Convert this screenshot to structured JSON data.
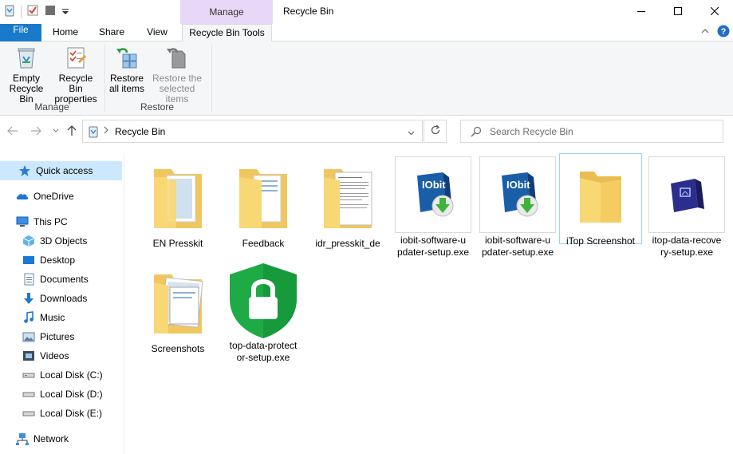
{
  "window": {
    "title": "Recycle Bin",
    "context_tab": "Manage"
  },
  "tabs": [
    {
      "label": "File"
    },
    {
      "label": "Home"
    },
    {
      "label": "Share"
    },
    {
      "label": "View"
    },
    {
      "label": "Recycle Bin Tools"
    }
  ],
  "ribbon": {
    "empty_line1": "Empty",
    "empty_line2": "Recycle Bin",
    "props_line1": "Recycle Bin",
    "props_line2": "properties",
    "manage_group": "Manage",
    "restore_all_line1": "Restore",
    "restore_all_line2": "all items",
    "restore_sel_line1": "Restore the",
    "restore_sel_line2": "selected items",
    "restore_group": "Restore"
  },
  "address": {
    "path": "Recycle Bin",
    "search_placeholder": "Search Recycle Bin"
  },
  "sidebar": {
    "items": [
      {
        "label": "Quick access",
        "icon": "star-icon"
      },
      {
        "label": "OneDrive",
        "icon": "cloud-icon"
      },
      {
        "label": "This PC",
        "icon": "computer-icon"
      },
      {
        "label": "3D Objects",
        "icon": "cube-icon"
      },
      {
        "label": "Desktop",
        "icon": "desktop-icon"
      },
      {
        "label": "Documents",
        "icon": "documents-icon"
      },
      {
        "label": "Downloads",
        "icon": "download-arrow-icon"
      },
      {
        "label": "Music",
        "icon": "music-note-icon"
      },
      {
        "label": "Pictures",
        "icon": "pictures-icon"
      },
      {
        "label": "Videos",
        "icon": "film-icon"
      },
      {
        "label": "Local Disk (C:)",
        "icon": "drive-icon"
      },
      {
        "label": "Local Disk (D:)",
        "icon": "drive-icon"
      },
      {
        "label": "Local Disk (E:)",
        "icon": "drive-icon"
      },
      {
        "label": "Network",
        "icon": "network-icon"
      }
    ]
  },
  "files": [
    {
      "line1": "EN Presskit",
      "line2": ""
    },
    {
      "line1": "Feedback",
      "line2": ""
    },
    {
      "line1": "idr_presskit_de",
      "line2": ""
    },
    {
      "line1": "iobit-software-u",
      "line2": "pdater-setup.exe"
    },
    {
      "line1": "iobit-software-u",
      "line2": "pdater-setup.exe"
    },
    {
      "line1": "iTop Screenshot",
      "line2": ""
    },
    {
      "line1": "itop-data-recove",
      "line2": "ry-setup.exe"
    },
    {
      "line1": "Screenshots",
      "line2": ""
    },
    {
      "line1": "top-data-protect",
      "line2": "or-setup.exe"
    }
  ],
  "colors": {
    "file_tab": "#1979ca",
    "manage_tab": "#e8d7f7",
    "selection": "#cce8ff",
    "folder": "#f8d775"
  }
}
